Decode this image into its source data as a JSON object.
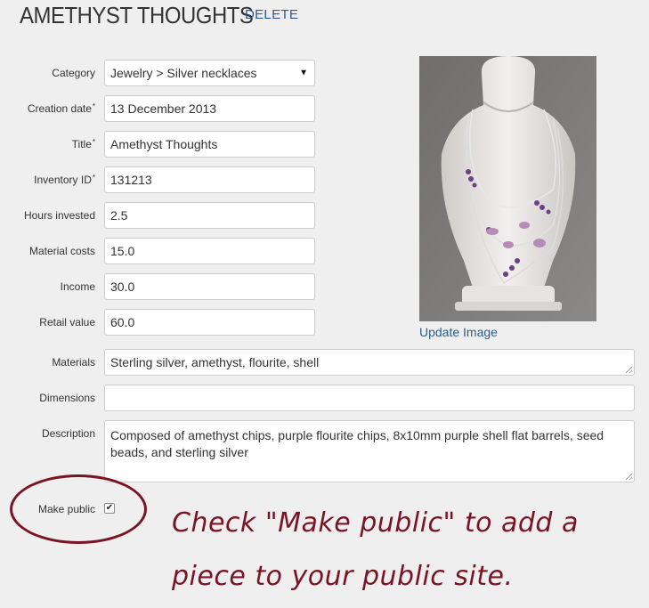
{
  "header": {
    "title": "AMETHYST THOUGHTS",
    "delete_label": "DELETE"
  },
  "form": {
    "category": {
      "label": "Category",
      "value": "Jewelry > Silver necklaces"
    },
    "creation_date": {
      "label": "Creation date",
      "required": "*",
      "value": "13 December 2013"
    },
    "title": {
      "label": "Title",
      "required": "*",
      "value": "Amethyst Thoughts"
    },
    "inventory_id": {
      "label": "Inventory ID",
      "required": "*",
      "value": "131213"
    },
    "hours_invested": {
      "label": "Hours invested",
      "value": "2.5"
    },
    "material_costs": {
      "label": "Material costs",
      "value": "15.0"
    },
    "income": {
      "label": "Income",
      "value": "30.0"
    },
    "retail_value": {
      "label": "Retail value",
      "value": "60.0"
    },
    "materials": {
      "label": "Materials",
      "value": "Sterling silver, amethyst, flourite, shell"
    },
    "dimensions": {
      "label": "Dimensions",
      "value": ""
    },
    "description": {
      "label": "Description",
      "value": "Composed of amethyst chips, purple flourite chips, 8x10mm purple shell flat barrels, seed beads, and sterling silver"
    },
    "make_public": {
      "label": "Make public",
      "checked": true,
      "check_glyph": "✔"
    }
  },
  "image": {
    "update_label": "Update Image"
  },
  "annotation": {
    "text": "Check \"Make public\" to add a piece to your public site."
  },
  "colors": {
    "link": "#2a5d8f",
    "annotation": "#7a1424",
    "background": "#efefef"
  }
}
